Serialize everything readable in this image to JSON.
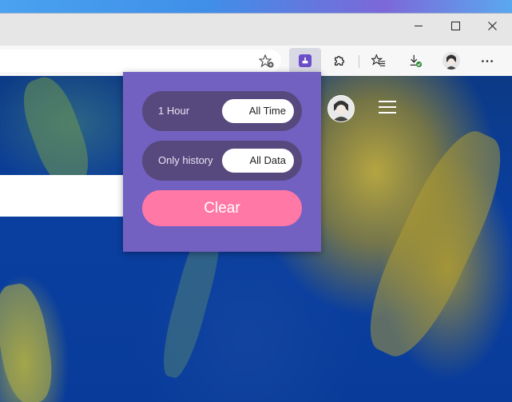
{
  "colors": {
    "popup_bg": "#7361c2",
    "toggle_bg": "#57497d",
    "clear_button": "#ff78a6",
    "extension_icon": "#6a4fc8"
  },
  "window": {
    "controls": [
      "minimize-icon",
      "maximize-icon",
      "close-icon"
    ]
  },
  "toolbar": {
    "icons": [
      "add-favorite-icon",
      "history-eraser-extension-icon",
      "extensions-puzzle-icon",
      "favorites-icon",
      "downloads-icon",
      "profile-avatar-icon",
      "more-icon"
    ]
  },
  "popup": {
    "time_toggle": {
      "left": "1 Hour",
      "right": "All Time",
      "selected": "All Time"
    },
    "data_toggle": {
      "left": "Only history",
      "right": "All Data",
      "selected": "All Data"
    },
    "clear_label": "Clear"
  }
}
